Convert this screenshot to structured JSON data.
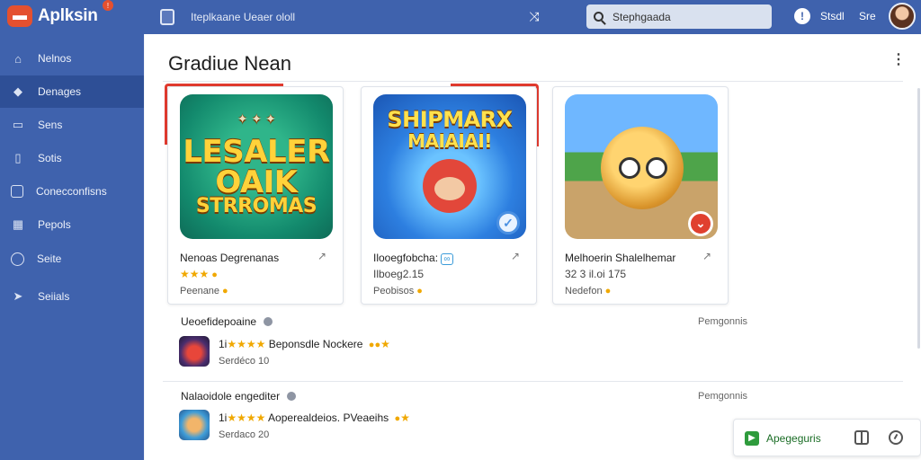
{
  "app": {
    "name": "Aplksin",
    "icon": "app-logo-icon",
    "badge": "!"
  },
  "topbar": {
    "breadcrumb": "Iteplkaane Ueaer ololl",
    "search_value": "Stephgaada",
    "link1": "Stsdl",
    "link2": "Sre"
  },
  "sidebar": {
    "items": [
      {
        "label": "Nelnos",
        "icon": "home-icon"
      },
      {
        "label": "Denages",
        "icon": "tag-icon",
        "active": true
      },
      {
        "label": "Sens",
        "icon": "folder-icon"
      },
      {
        "label": "Sotis",
        "icon": "device-icon"
      },
      {
        "label": "Conecconfisns",
        "icon": "window-icon"
      },
      {
        "label": "Pepols",
        "icon": "grid-icon"
      },
      {
        "label": "Seite",
        "icon": "circle-icon"
      },
      {
        "label": "Seiials",
        "icon": "share-icon"
      }
    ]
  },
  "main": {
    "title": "Gradiue Nean",
    "cards": [
      {
        "title": "Nenoas Degrenanas",
        "rating": "★★★",
        "sub": "Peenane",
        "image_text_top": "LESALER",
        "image_text_mid": "OAIK",
        "image_text_bot": "STRROMAS"
      },
      {
        "title": "Ilooegfobcha:",
        "title_tag": "∞",
        "rating": "Ilboeg2.15",
        "sub": "Peobisos",
        "image_text_top": "SHIPMARX",
        "image_text_mid": "MAIAIAI!"
      },
      {
        "title": "Melhoerin Shalelhemar",
        "rating": "32 3 il.oi 175",
        "sub": "Nedefon",
        "image_text_top": "",
        "image_text_mid": ""
      }
    ],
    "list": [
      {
        "heading": "Ueoefidepoaine",
        "meta": "Pemgonnis",
        "rating_prefix": "1i",
        "stars": "★★★★",
        "text": "Beponsdle Nockere",
        "tail": "★",
        "sub": "Serdéco 10"
      },
      {
        "heading": "Nalaoidole engediter",
        "meta": "Pemgonnis",
        "rating_prefix": "1i",
        "stars": "★★★★",
        "text": "Aoperealdeios. PVeaeihs",
        "tail": "★",
        "sub": "Serdaco 20"
      }
    ]
  },
  "toast": {
    "label": "Apegeguris"
  },
  "colors": {
    "primary": "#3f62ad",
    "active": "#2e4f96",
    "accent_red": "#e03a2f",
    "star": "#f0a800",
    "success": "#2e9b3c"
  }
}
